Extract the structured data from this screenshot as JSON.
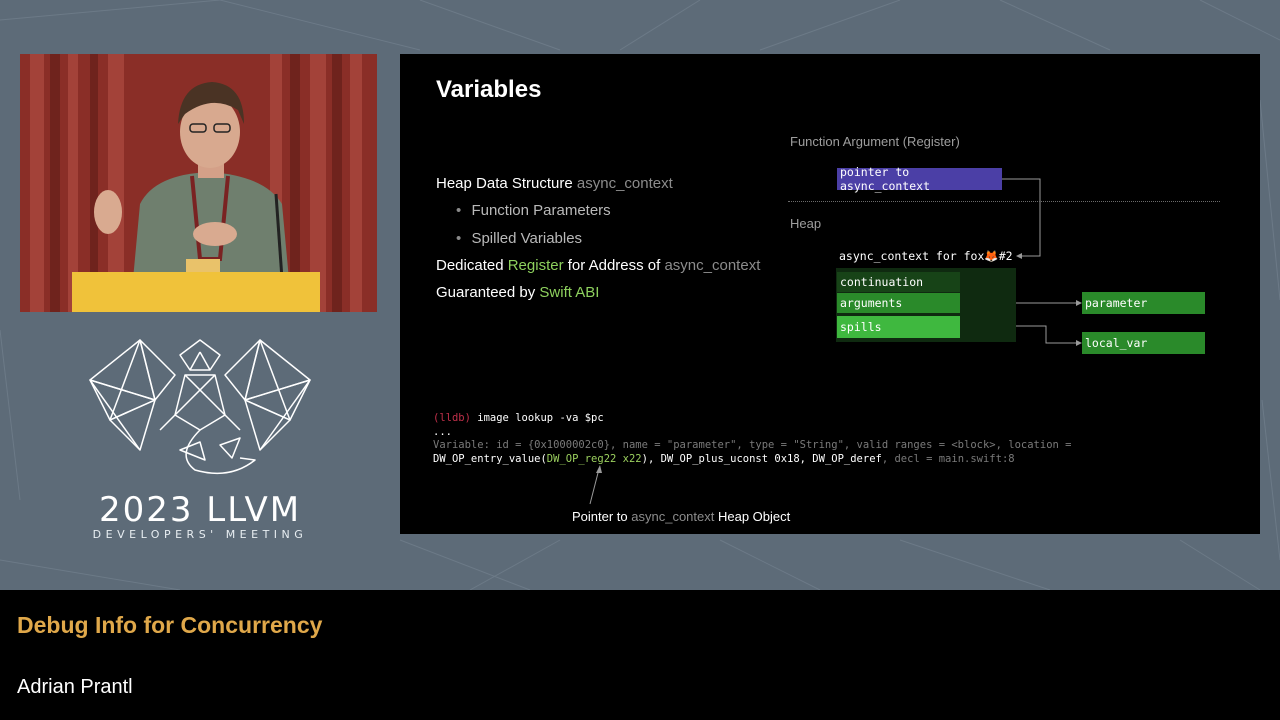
{
  "slide": {
    "title": "Variables",
    "bullets": {
      "b1_text": "Heap Data Structure ",
      "b1_code": "async_context",
      "b2_text": "Function Parameters",
      "b3_text": "Spilled Variables",
      "b4_pre": "Dedicated ",
      "b4_hl": "Register",
      "b4_mid": " for Address of ",
      "b4_code": "async_context",
      "b5_pre": "Guaranteed by ",
      "b5_hl": "Swift ABI"
    },
    "diagram": {
      "register_heading": "Function Argument (Register)",
      "pointer_box": "pointer to async_context",
      "heap_heading": "Heap",
      "context_header": "async_context for fox🦊#2",
      "field_continuation": "continuation",
      "field_arguments": "arguments",
      "field_spills": "spills",
      "target_parameter": "parameter",
      "target_local_var": "local_var"
    },
    "code": {
      "prompt": "(lldb)",
      "command": " image lookup -va $pc",
      "ellipsis": "...",
      "variable_line": "Variable: id = {0x1000002c0}, name = \"parameter\", type = \"String\", valid ranges = <block>, location =",
      "loc_pre": "DW_OP_entry_value(",
      "loc_hl": "DW_OP_reg22 x22",
      "loc_post": "), DW_OP_plus_uconst 0x18, DW_OP_deref",
      "loc_dim": ", decl = main.swift:8"
    },
    "caption": {
      "pre": "Pointer to ",
      "code": "async_context",
      "post": " Heap Object"
    }
  },
  "logo": {
    "year": "2023 LLVM",
    "subtitle": "DEVELOPERS' MEETING"
  },
  "lower_third": {
    "talk_title": "Debug Info for Concurrency",
    "speaker": "Adrian Prantl"
  },
  "colors": {
    "background": "#5d6b78",
    "title_accent": "#e0a84a",
    "pointer_box": "#4b3fa6",
    "green_field": "#2a8a2a",
    "spills_field": "#3fb83f"
  }
}
